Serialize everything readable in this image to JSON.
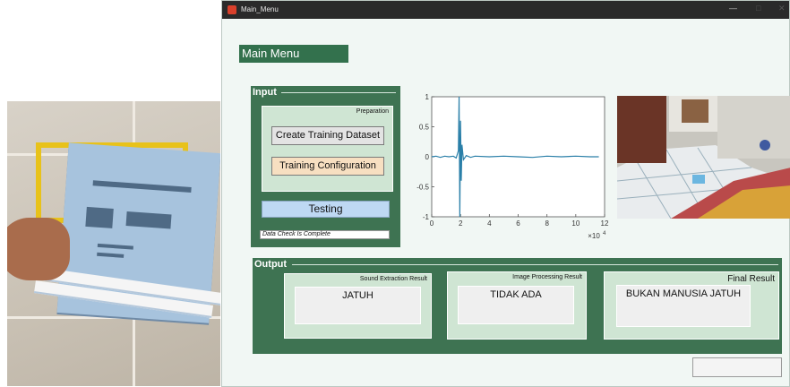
{
  "window": {
    "title": "Main_Menu",
    "minimize_icon": "minimize-icon",
    "maximize_icon": "maximize-icon",
    "close_icon": "close-icon"
  },
  "main_menu_label": "Main Menu",
  "input_panel": {
    "title": "Input",
    "preparation": {
      "title": "Preparation",
      "create_dataset_label": "Create Training Dataset",
      "training_config_label": "Training Configuration"
    },
    "testing_label": "Testing",
    "status_text": "Data Check Is Complete"
  },
  "chart_data": {
    "type": "line",
    "series": [
      {
        "x": [
          0,
          0.3,
          0.6,
          0.9,
          1.2,
          1.5,
          1.7,
          1.85,
          1.9,
          1.95,
          2.0,
          2.05,
          2.1,
          2.2,
          2.4,
          2.7,
          3.0,
          4.0,
          5.0,
          6.0,
          7.0,
          8.0,
          9.0,
          10.0,
          11.0,
          11.6
        ],
        "y": [
          0,
          0.01,
          -0.01,
          0.01,
          0,
          0.01,
          -0.02,
          0.1,
          1.0,
          -1.0,
          0.6,
          -0.4,
          0.2,
          -0.05,
          0.02,
          -0.01,
          0.01,
          0,
          0.01,
          0,
          -0.01,
          0.01,
          0,
          0.01,
          0,
          0
        ]
      }
    ],
    "xlim": [
      0,
      12
    ],
    "ylim": [
      -1,
      1
    ],
    "x_ticks": [
      "0",
      "2",
      "4",
      "6",
      "8",
      "10",
      "12"
    ],
    "y_ticks": [
      "1",
      "0.5",
      "0",
      "-0.5",
      "-1"
    ],
    "x_exponent_label": "×10",
    "x_exponent": "4",
    "line_color": "#2a7fa8"
  },
  "output_panel": {
    "title": "Output",
    "sound": {
      "title": "Sound Extraction Result",
      "value": "JATUH"
    },
    "image": {
      "title": "Image Processing Result",
      "value": "TIDAK ADA"
    },
    "final": {
      "title": "Final Result",
      "value": "BUKAN MANUSIA JATUH"
    }
  }
}
